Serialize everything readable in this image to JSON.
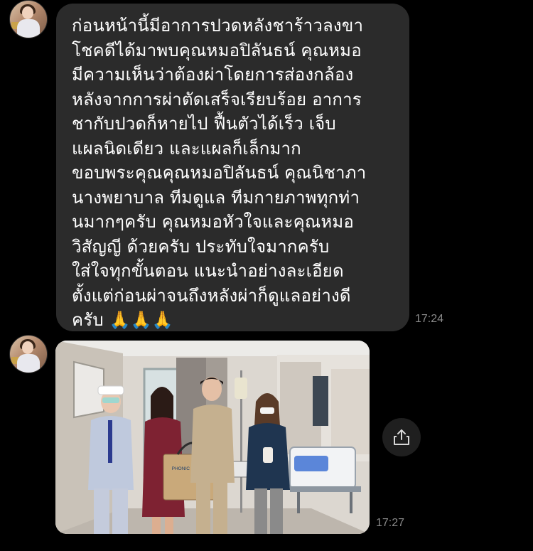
{
  "messages": [
    {
      "type": "text",
      "text": "ก่อนหน้านี้มีอาการปวดหลังชาร้าวลงขา\nโชคดีได้มาพบคุณหมอปิลันธน์ คุณหมอ\nมีความเห็นว่าต้องผ่าโดยการส่องกล้อง\nหลังจากการผ่าตัดเสร็จเรียบร้อย อาการ\nชากับปวดก็หายไป  ฟื้นตัวได้เร็ว  เจ็บ\nแผลนิดเดียว และแผลก็เล็กมาก\nขอบพระคุณคุณหมอปิลันธน์ คุณนิชาภา\nนางพยาบาล ทีมดูแล ทีมกายภาพทุกท่า\nนมากๆครับ คุณหมอหัวใจและคุณหมอ\nวิสัญญี ด้วยครับ ประทับใจมากครับ\nใส่ใจทุกขั้นตอน แนะนำอย่างละเอียด\nตั้งแต่ก่อนผ่าจนถึงหลังผ่าก็ดูแลอย่างดี\nครับ 🙏🙏🙏",
      "time": "17:24"
    },
    {
      "type": "image",
      "bag_label": "PHONIC HOSPITAL",
      "time": "17:27"
    }
  ],
  "colors": {
    "background": "#000000",
    "bubble": "#2b2b2b",
    "text": "#ffffff",
    "timestamp": "#8a8a8a"
  },
  "icons": {
    "share": "share-icon"
  }
}
